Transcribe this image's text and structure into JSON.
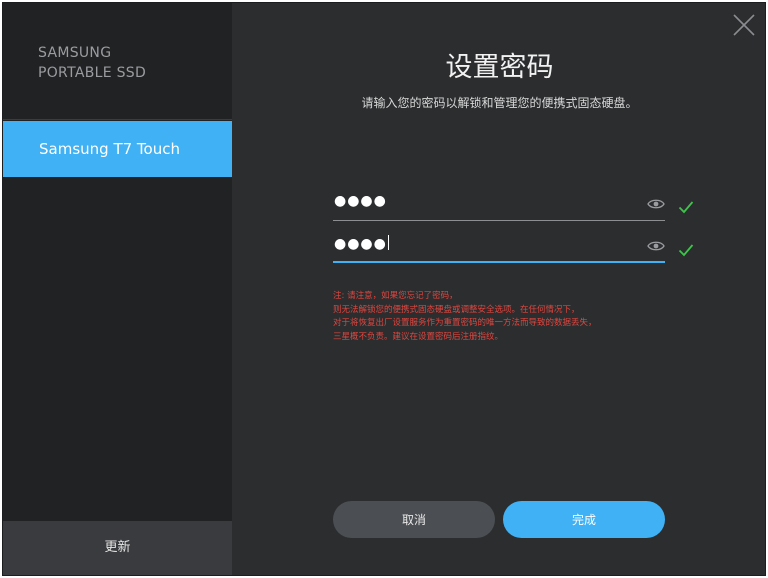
{
  "sidebar": {
    "brand_line1": "SAMSUNG",
    "brand_line2": "PORTABLE SSD",
    "device_label": "Samsung T7 Touch",
    "update_label": "更新"
  },
  "dialog": {
    "title": "设置密码",
    "subtitle": "请输入您的密码以解锁和管理您的便携式固态硬盘。",
    "password_masked": "●●●●",
    "confirm_masked": "●●●●",
    "warning_lines": [
      "注: 请注意，如果您忘记了密码，",
      "则无法解锁您的便携式固态硬盘或调整安全选项。在任何情况下，",
      "对于将恢复出厂设置服务作为重置密码的唯一方法而导致的数据丢失，",
      "三星概不负责。建议在设置密码后注册指纹。"
    ],
    "cancel_label": "取消",
    "done_label": "完成"
  },
  "colors": {
    "accent": "#3fb1f4",
    "valid_check": "#3ec44a",
    "warning_text": "#e0463f"
  },
  "icons": [
    "close-icon",
    "eye-icon",
    "check-icon"
  ]
}
